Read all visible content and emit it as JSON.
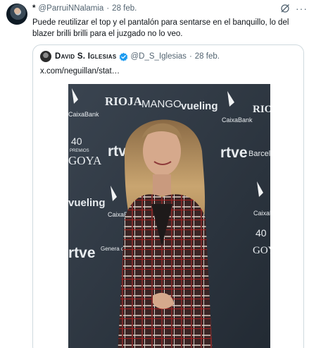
{
  "tweet": {
    "star": "*",
    "handle": "@ParruiNNalamia",
    "separator": "·",
    "date": "28 feb.",
    "text": "Puede reutilizar el top y el pantalón para sentarse en el banquillo, lo del blazer brilli brilli para el juzgado no lo veo."
  },
  "quote": {
    "name": "David S. Iglesias",
    "handle": "@D_S_Iglesias",
    "separator": "·",
    "date": "28 feb.",
    "link_text": "x.com/neguillan/stat…"
  },
  "photo_backdrop": {
    "rioja": "RIOJA",
    "mango": "MANGO",
    "vueling": "vueling",
    "caixabank": "CaixaBank",
    "rtve": "rtve",
    "goya_number": "40",
    "goya_premios": "PREMIOS",
    "goya_word": "GOYA",
    "barcelona": "Barcelon",
    "generalitat": "Genera de Cata"
  },
  "colors": {
    "text": "#0f1419",
    "muted": "#536471",
    "verified": "#1d9bf0",
    "border": "#cfd9de",
    "backdrop": "#2e3742"
  }
}
